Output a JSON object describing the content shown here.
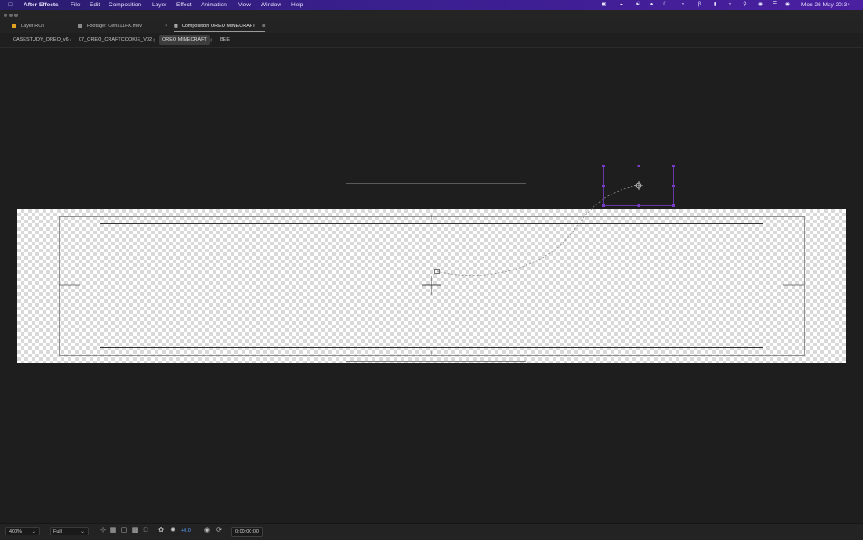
{
  "menubar": {
    "app_name": "After Effects",
    "items": [
      "File",
      "Edit",
      "Composition",
      "Layer",
      "Effect",
      "Animation",
      "View",
      "Window",
      "Help"
    ],
    "clock": "Mon 26 May  20:34"
  },
  "tabs": [
    {
      "label": "Layer ROT",
      "color": "#e0a020"
    },
    {
      "label": "Footage: Cerla11FX.mov",
      "color": "#8a8a8a"
    },
    {
      "label": "Composition OREO MINECRAFT",
      "color": "#9a9a9a",
      "active": true
    }
  ],
  "breadcrumbs": [
    "CASESTUDY_OREO_v6",
    "07_OREO_CRAFTCOOKIE_V02",
    "OREO MINECRAFT",
    "BEE"
  ],
  "breadcrumb_active_index": 2,
  "bottombar": {
    "zoom": "400%",
    "resolution": "Full",
    "exposure": "+0.0",
    "timecode": "0:00:00:00"
  },
  "colors": {
    "accent_blue": "#5aa2ff",
    "selection_purple": "#7a3cc8",
    "menubar": "#3a1f8f"
  },
  "icons": [
    "apple-icon",
    "grid-icon",
    "region-icon",
    "transparency-icon",
    "mask-icon",
    "color-icon",
    "exposure-icon",
    "camera-icon",
    "snapshot-icon"
  ]
}
